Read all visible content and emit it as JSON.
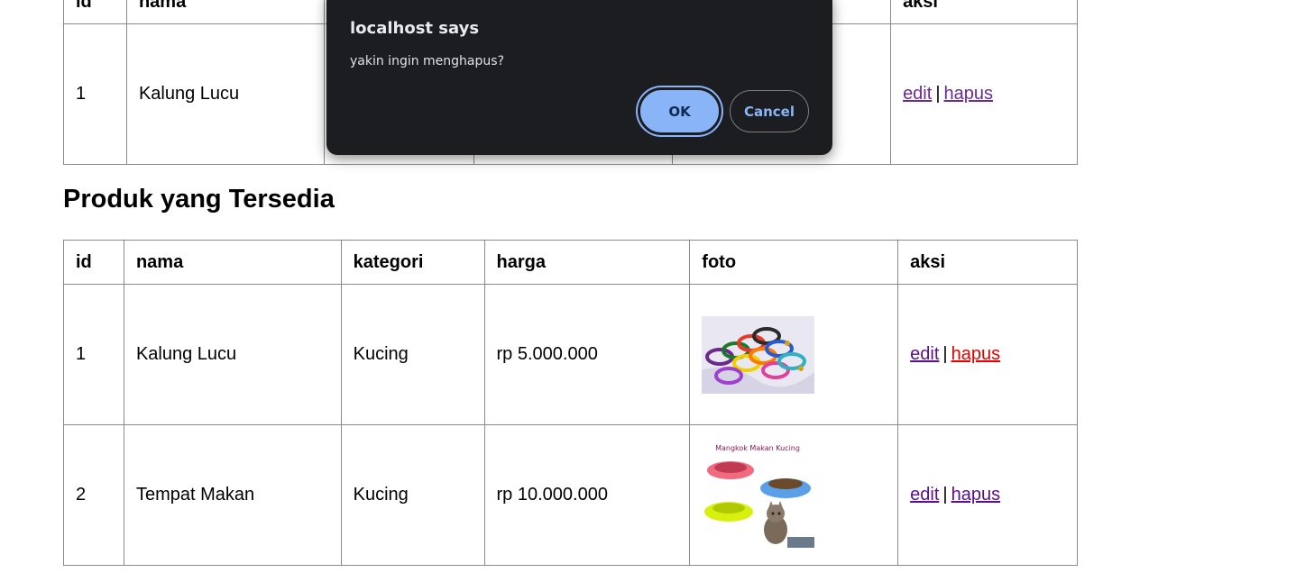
{
  "top_table": {
    "headers": [
      "id",
      "nama",
      "aksi"
    ],
    "row": {
      "id": "1",
      "nama": "Kalung Lucu",
      "edit": "edit",
      "sep": "|",
      "hapus": "hapus"
    }
  },
  "section_title": "Produk yang Tersedia",
  "products": {
    "headers": [
      "id",
      "nama",
      "kategori",
      "harga",
      "foto",
      "aksi"
    ],
    "rows": [
      {
        "id": "1",
        "nama": "Kalung Lucu",
        "kategori": "Kucing",
        "harga": "rp 5.000.000",
        "edit": "edit",
        "sep": "|",
        "hapus": "hapus"
      },
      {
        "id": "2",
        "nama": "Tempat Makan",
        "kategori": "Kucing",
        "harga": "rp 10.000.000",
        "edit": "edit",
        "sep": "|",
        "hapus": "hapus",
        "photo_caption": "Mangkok Makan Kucing"
      }
    ]
  },
  "dialog": {
    "title": "localhost says",
    "message": "yakin ingin menghapus?",
    "ok_label": "OK",
    "cancel_label": "Cancel"
  },
  "colors": {
    "dialog_bg": "#1c1d21",
    "ok_button": "#8ab4f8",
    "link_visited": "#5a0f8c",
    "link_hover": "#e60000"
  }
}
